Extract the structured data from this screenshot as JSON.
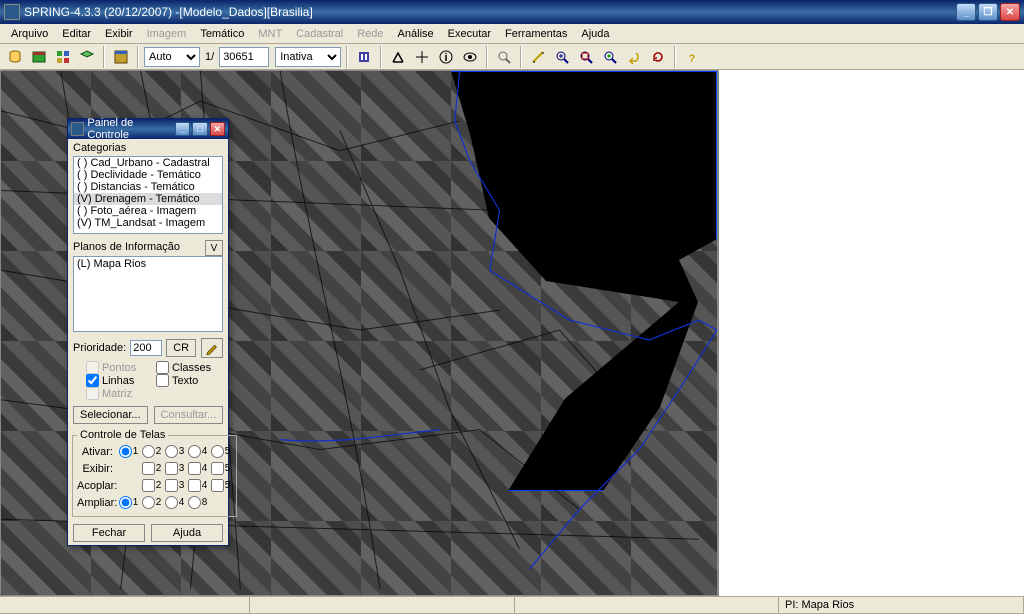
{
  "title": "SPRING-4.3.3 (20/12/2007) -[Modelo_Dados][Brasilia]",
  "menu": [
    "Arquivo",
    "Editar",
    "Exibir",
    "Imagem",
    "Temático",
    "MNT",
    "Cadastral",
    "Rede",
    "Análise",
    "Executar",
    "Ferramentas",
    "Ajuda"
  ],
  "menu_disabled": [
    3,
    5,
    6,
    7
  ],
  "toolbar": {
    "auto": "Auto",
    "scale_prefix": "1/",
    "scale_value": "30651",
    "inativa": "Inativa"
  },
  "panel": {
    "title": "Painel de Controle",
    "categorias_label": "Categorias",
    "categorias": [
      "( ) Cad_Urbano - Cadastral",
      "( ) Declividade - Temático",
      "( ) Distancias - Temático",
      "(V) Drenagem - Temático",
      "( ) Foto_aérea - Imagem",
      "(V) TM_Landsat - Imagem"
    ],
    "categorias_sel_index": 3,
    "planos_label": "Planos de Informação",
    "planos_vbtn": "V",
    "planos_item": "(L) Mapa Rios",
    "prioridade_label": "Prioridade:",
    "prioridade_value": "200",
    "cr_btn": "CR",
    "chk_pontos": "Pontos",
    "chk_classes": "Classes",
    "chk_linhas": "Linhas",
    "chk_texto": "Texto",
    "chk_matriz": "Matriz",
    "selecionar_btn": "Selecionar...",
    "consultar_btn": "Consultar...",
    "controle_label": "Controle de Telas",
    "ativar_label": "Ativar:",
    "exibir_label": "Exibir:",
    "acoplar_label": "Acoplar:",
    "ampliar_label": "Ampliar:",
    "fechar_btn": "Fechar",
    "ajuda_btn": "Ajuda"
  },
  "status": {
    "pi": "PI: Mapa Rios"
  }
}
